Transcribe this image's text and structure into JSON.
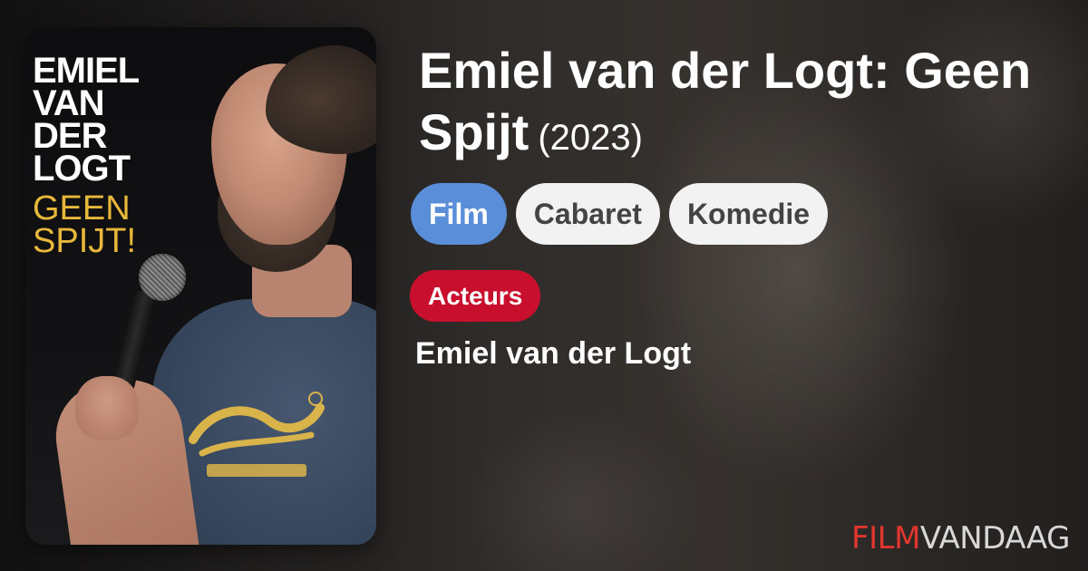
{
  "poster": {
    "title_lines": [
      "EMIEL",
      "VAN",
      "DER",
      "LOGT"
    ],
    "subtitle_lines": [
      "GEEN",
      "SPIJT!"
    ],
    "subtitle_color": "#e8b83a"
  },
  "movie": {
    "title": "Emiel van der Logt: Geen Spijt",
    "year": "(2023)"
  },
  "tags": [
    {
      "label": "Film",
      "style": "primary",
      "color": "#5a8ed9"
    },
    {
      "label": "Cabaret",
      "style": "secondary",
      "color": "#f2f2f2"
    },
    {
      "label": "Komedie",
      "style": "secondary",
      "color": "#f2f2f2"
    }
  ],
  "cast": {
    "role_label": "Acteurs",
    "role_color": "#c8102e",
    "names": [
      "Emiel van der Logt"
    ]
  },
  "brand": {
    "part1": "FILM",
    "part2": "VANDAAG",
    "part1_color": "#e1362e"
  }
}
